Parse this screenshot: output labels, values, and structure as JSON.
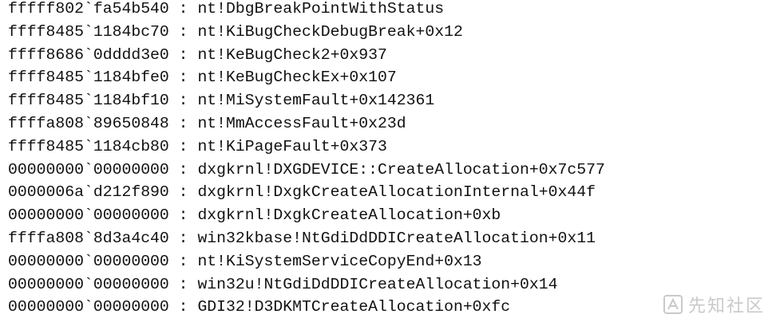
{
  "stack_trace": {
    "separator": " : ",
    "frames": [
      {
        "address": "fffff802`fa54b540",
        "symbol": "nt!DbgBreakPointWithStatus"
      },
      {
        "address": "ffff8485`1184bc70",
        "symbol": "nt!KiBugCheckDebugBreak+0x12"
      },
      {
        "address": "ffff8686`0dddd3e0",
        "symbol": "nt!KeBugCheck2+0x937"
      },
      {
        "address": "ffff8485`1184bfe0",
        "symbol": "nt!KeBugCheckEx+0x107"
      },
      {
        "address": "ffff8485`1184bf10",
        "symbol": "nt!MiSystemFault+0x142361"
      },
      {
        "address": "ffffa808`89650848",
        "symbol": "nt!MmAccessFault+0x23d"
      },
      {
        "address": "ffff8485`1184cb80",
        "symbol": "nt!KiPageFault+0x373"
      },
      {
        "address": "00000000`00000000",
        "symbol": "dxgkrnl!DXGDEVICE::CreateAllocation+0x7c577"
      },
      {
        "address": "0000006a`d212f890",
        "symbol": "dxgkrnl!DxgkCreateAllocationInternal+0x44f"
      },
      {
        "address": "00000000`00000000",
        "symbol": "dxgkrnl!DxgkCreateAllocation+0xb"
      },
      {
        "address": "ffffa808`8d3a4c40",
        "symbol": "win32kbase!NtGdiDdDDICreateAllocation+0x11"
      },
      {
        "address": "00000000`00000000",
        "symbol": "nt!KiSystemServiceCopyEnd+0x13"
      },
      {
        "address": "00000000`00000000",
        "symbol": "win32u!NtGdiDdDDICreateAllocation+0x14"
      },
      {
        "address": "00000000`00000000",
        "symbol": "GDI32!D3DKMTCreateAllocation+0xfc"
      }
    ]
  },
  "watermark": {
    "text": "先知社区",
    "icon": "xianzhi-logo-icon",
    "color": "#9aa0a6"
  }
}
